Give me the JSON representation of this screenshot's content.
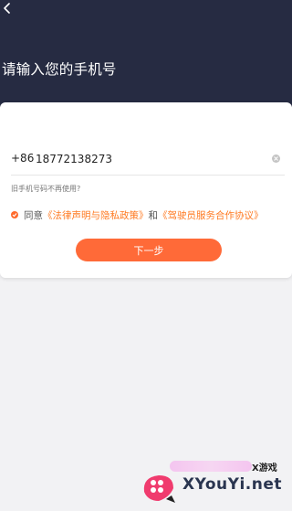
{
  "header": {
    "title": "请输入您的手机号"
  },
  "form": {
    "country_code": "+86",
    "phone_value": "18772138273",
    "old_phone_link": "旧手机号码不再使用?",
    "agree_prefix": "同意",
    "legal_link": "《法律声明与隐私政策》",
    "agree_and": "和",
    "driver_link": "《驾驶员服务合作协议》",
    "next_label": "下一步"
  },
  "colors": {
    "header_bg": "#262b42",
    "accent": "#ff6a38",
    "link": "#ff7a22"
  },
  "icons": {
    "back": "chevron-left-icon",
    "clear": "clear-icon",
    "check": "check-icon"
  },
  "watermark": {
    "cn": "X游戏",
    "en": "XYouYi.net"
  }
}
